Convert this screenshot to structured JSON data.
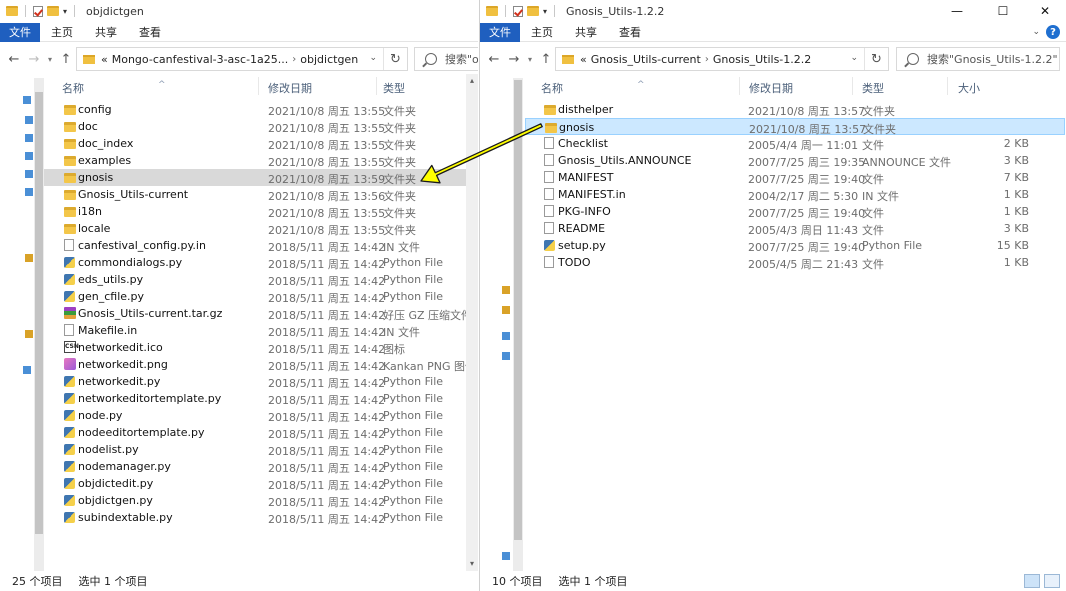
{
  "left": {
    "title": "objdictgen",
    "ribbon": {
      "file": "文件",
      "tabs": [
        "主页",
        "共享",
        "查看"
      ]
    },
    "address": {
      "prefix": "«",
      "segments": [
        "Mongo-canfestival-3-asc-1a25...",
        "objdictgen"
      ]
    },
    "search_placeholder": "搜索\"o",
    "columns": [
      "名称",
      "修改日期",
      "类型"
    ],
    "files": [
      {
        "name": "config",
        "date": "2021/10/8 周五 13:55",
        "type": "文件夹",
        "icon": "folder-icon"
      },
      {
        "name": "doc",
        "date": "2021/10/8 周五 13:55",
        "type": "文件夹",
        "icon": "folder-icon"
      },
      {
        "name": "doc_index",
        "date": "2021/10/8 周五 13:55",
        "type": "文件夹",
        "icon": "folder-icon"
      },
      {
        "name": "examples",
        "date": "2021/10/8 周五 13:55",
        "type": "文件夹",
        "icon": "folder-icon"
      },
      {
        "name": "gnosis",
        "date": "2021/10/8 周五 13:59",
        "type": "文件夹",
        "icon": "folder-icon",
        "selected": true
      },
      {
        "name": "Gnosis_Utils-current",
        "date": "2021/10/8 周五 13:56",
        "type": "文件夹",
        "icon": "folder-icon"
      },
      {
        "name": "i18n",
        "date": "2021/10/8 周五 13:55",
        "type": "文件夹",
        "icon": "folder-icon"
      },
      {
        "name": "locale",
        "date": "2021/10/8 周五 13:55",
        "type": "文件夹",
        "icon": "folder-icon"
      },
      {
        "name": "canfestival_config.py.in",
        "date": "2018/5/11 周五 14:42",
        "type": "IN 文件",
        "icon": "file-icon"
      },
      {
        "name": "commondialogs.py",
        "date": "2018/5/11 周五 14:42",
        "type": "Python File",
        "icon": "python-file-icon"
      },
      {
        "name": "eds_utils.py",
        "date": "2018/5/11 周五 14:42",
        "type": "Python File",
        "icon": "python-file-icon"
      },
      {
        "name": "gen_cfile.py",
        "date": "2018/5/11 周五 14:42",
        "type": "Python File",
        "icon": "python-file-icon"
      },
      {
        "name": "Gnosis_Utils-current.tar.gz",
        "date": "2018/5/11 周五 14:42",
        "type": "好压 GZ 压缩文件",
        "icon": "archive-icon"
      },
      {
        "name": "Makefile.in",
        "date": "2018/5/11 周五 14:42",
        "type": "IN 文件",
        "icon": "file-icon"
      },
      {
        "name": "networkedit.ico",
        "date": "2018/5/11 周五 14:42",
        "type": "图标",
        "icon": "ico-file-icon"
      },
      {
        "name": "networkedit.png",
        "date": "2018/5/11 周五 14:42",
        "type": "Kankan PNG 图像",
        "icon": "image-file-icon"
      },
      {
        "name": "networkedit.py",
        "date": "2018/5/11 周五 14:42",
        "type": "Python File",
        "icon": "python-file-icon"
      },
      {
        "name": "networkeditortemplate.py",
        "date": "2018/5/11 周五 14:42",
        "type": "Python File",
        "icon": "python-file-icon"
      },
      {
        "name": "node.py",
        "date": "2018/5/11 周五 14:42",
        "type": "Python File",
        "icon": "python-file-icon"
      },
      {
        "name": "nodeeditortemplate.py",
        "date": "2018/5/11 周五 14:42",
        "type": "Python File",
        "icon": "python-file-icon"
      },
      {
        "name": "nodelist.py",
        "date": "2018/5/11 周五 14:42",
        "type": "Python File",
        "icon": "python-file-icon"
      },
      {
        "name": "nodemanager.py",
        "date": "2018/5/11 周五 14:42",
        "type": "Python File",
        "icon": "python-file-icon"
      },
      {
        "name": "objdictedit.py",
        "date": "2018/5/11 周五 14:42",
        "type": "Python File",
        "icon": "python-file-icon"
      },
      {
        "name": "objdictgen.py",
        "date": "2018/5/11 周五 14:42",
        "type": "Python File",
        "icon": "python-file-icon"
      },
      {
        "name": "subindextable.py",
        "date": "2018/5/11 周五 14:42",
        "type": "Python File",
        "icon": "python-file-icon"
      }
    ],
    "status": {
      "count": "25 个项目",
      "selected": "选中 1 个项目"
    }
  },
  "right": {
    "title": "Gnosis_Utils-1.2.2",
    "window_controls": {
      "minimize": "—",
      "maximize": "☐",
      "close": "✕"
    },
    "ribbon": {
      "file": "文件",
      "tabs": [
        "主页",
        "共享",
        "查看"
      ]
    },
    "address": {
      "prefix": "«",
      "segments": [
        "Gnosis_Utils-current",
        "Gnosis_Utils-1.2.2"
      ]
    },
    "search_placeholder": "搜索\"Gnosis_Utils-1.2.2\"",
    "columns": [
      "名称",
      "修改日期",
      "类型",
      "大小"
    ],
    "files": [
      {
        "name": "disthelper",
        "date": "2021/10/8 周五 13:57",
        "type": "文件夹",
        "size": "",
        "icon": "folder-icon"
      },
      {
        "name": "gnosis",
        "date": "2021/10/8 周五 13:57",
        "type": "文件夹",
        "size": "",
        "icon": "folder-icon",
        "selected": true
      },
      {
        "name": "Checklist",
        "date": "2005/4/4 周一 11:01",
        "type": "文件",
        "size": "2 KB",
        "icon": "file-icon"
      },
      {
        "name": "Gnosis_Utils.ANNOUNCE",
        "date": "2007/7/25 周三 19:35",
        "type": "ANNOUNCE 文件",
        "size": "3 KB",
        "icon": "file-icon"
      },
      {
        "name": "MANIFEST",
        "date": "2007/7/25 周三 19:40",
        "type": "文件",
        "size": "7 KB",
        "icon": "file-icon"
      },
      {
        "name": "MANIFEST.in",
        "date": "2004/2/17 周二 5:30",
        "type": "IN 文件",
        "size": "1 KB",
        "icon": "file-icon"
      },
      {
        "name": "PKG-INFO",
        "date": "2007/7/25 周三 19:40",
        "type": "文件",
        "size": "1 KB",
        "icon": "file-icon"
      },
      {
        "name": "README",
        "date": "2005/4/3 周日 11:43",
        "type": "文件",
        "size": "3 KB",
        "icon": "file-icon"
      },
      {
        "name": "setup.py",
        "date": "2007/7/25 周三 19:40",
        "type": "Python File",
        "size": "15 KB",
        "icon": "python-file-icon"
      },
      {
        "name": "TODO",
        "date": "2005/4/5 周二 21:43",
        "type": "文件",
        "size": "1 KB",
        "icon": "file-icon"
      }
    ],
    "status": {
      "count": "10 个项目",
      "selected": "选中 1 个项目"
    }
  },
  "colors": {
    "ribbon_file": "#1f5fbf",
    "selection_blue": "#cce8ff",
    "selection_gray": "#d9d9d9",
    "arrow": "#ffff00"
  }
}
